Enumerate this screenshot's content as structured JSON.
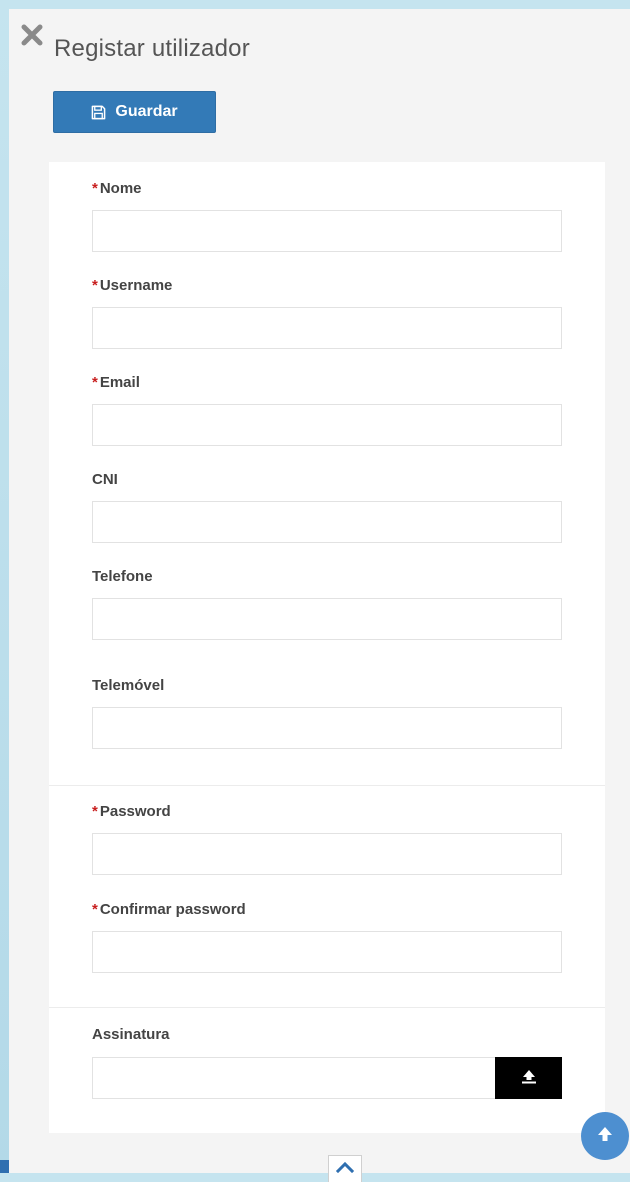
{
  "dialog": {
    "title": "Registar utilizador"
  },
  "toolbar": {
    "save_label": "Guardar"
  },
  "form": {
    "required_marker": "*",
    "fields": {
      "nome": {
        "label": "Nome",
        "value": "",
        "required": true
      },
      "username": {
        "label": "Username",
        "value": "",
        "required": true
      },
      "email": {
        "label": "Email",
        "value": "",
        "required": true
      },
      "cni": {
        "label": "CNI",
        "value": "",
        "required": false
      },
      "telefone": {
        "label": "Telefone",
        "value": "",
        "required": false
      },
      "telemovel": {
        "label": "Telemóvel",
        "value": "",
        "required": false
      },
      "password": {
        "label": "Password",
        "value": "",
        "required": true
      },
      "confirmar": {
        "label": "Confirmar password",
        "value": "",
        "required": true
      },
      "assinatura": {
        "label": "Assinatura",
        "value": "",
        "required": false
      }
    }
  },
  "icons": {
    "close": "close-icon",
    "save": "save-icon",
    "upload": "upload-icon",
    "scroll_top": "arrow-up-icon",
    "collapse": "chevron-up-icon"
  },
  "colors": {
    "primary": "#337ab7",
    "required": "#c81e1e",
    "fab": "#4d8fd0",
    "background": "#c5e4ef"
  }
}
